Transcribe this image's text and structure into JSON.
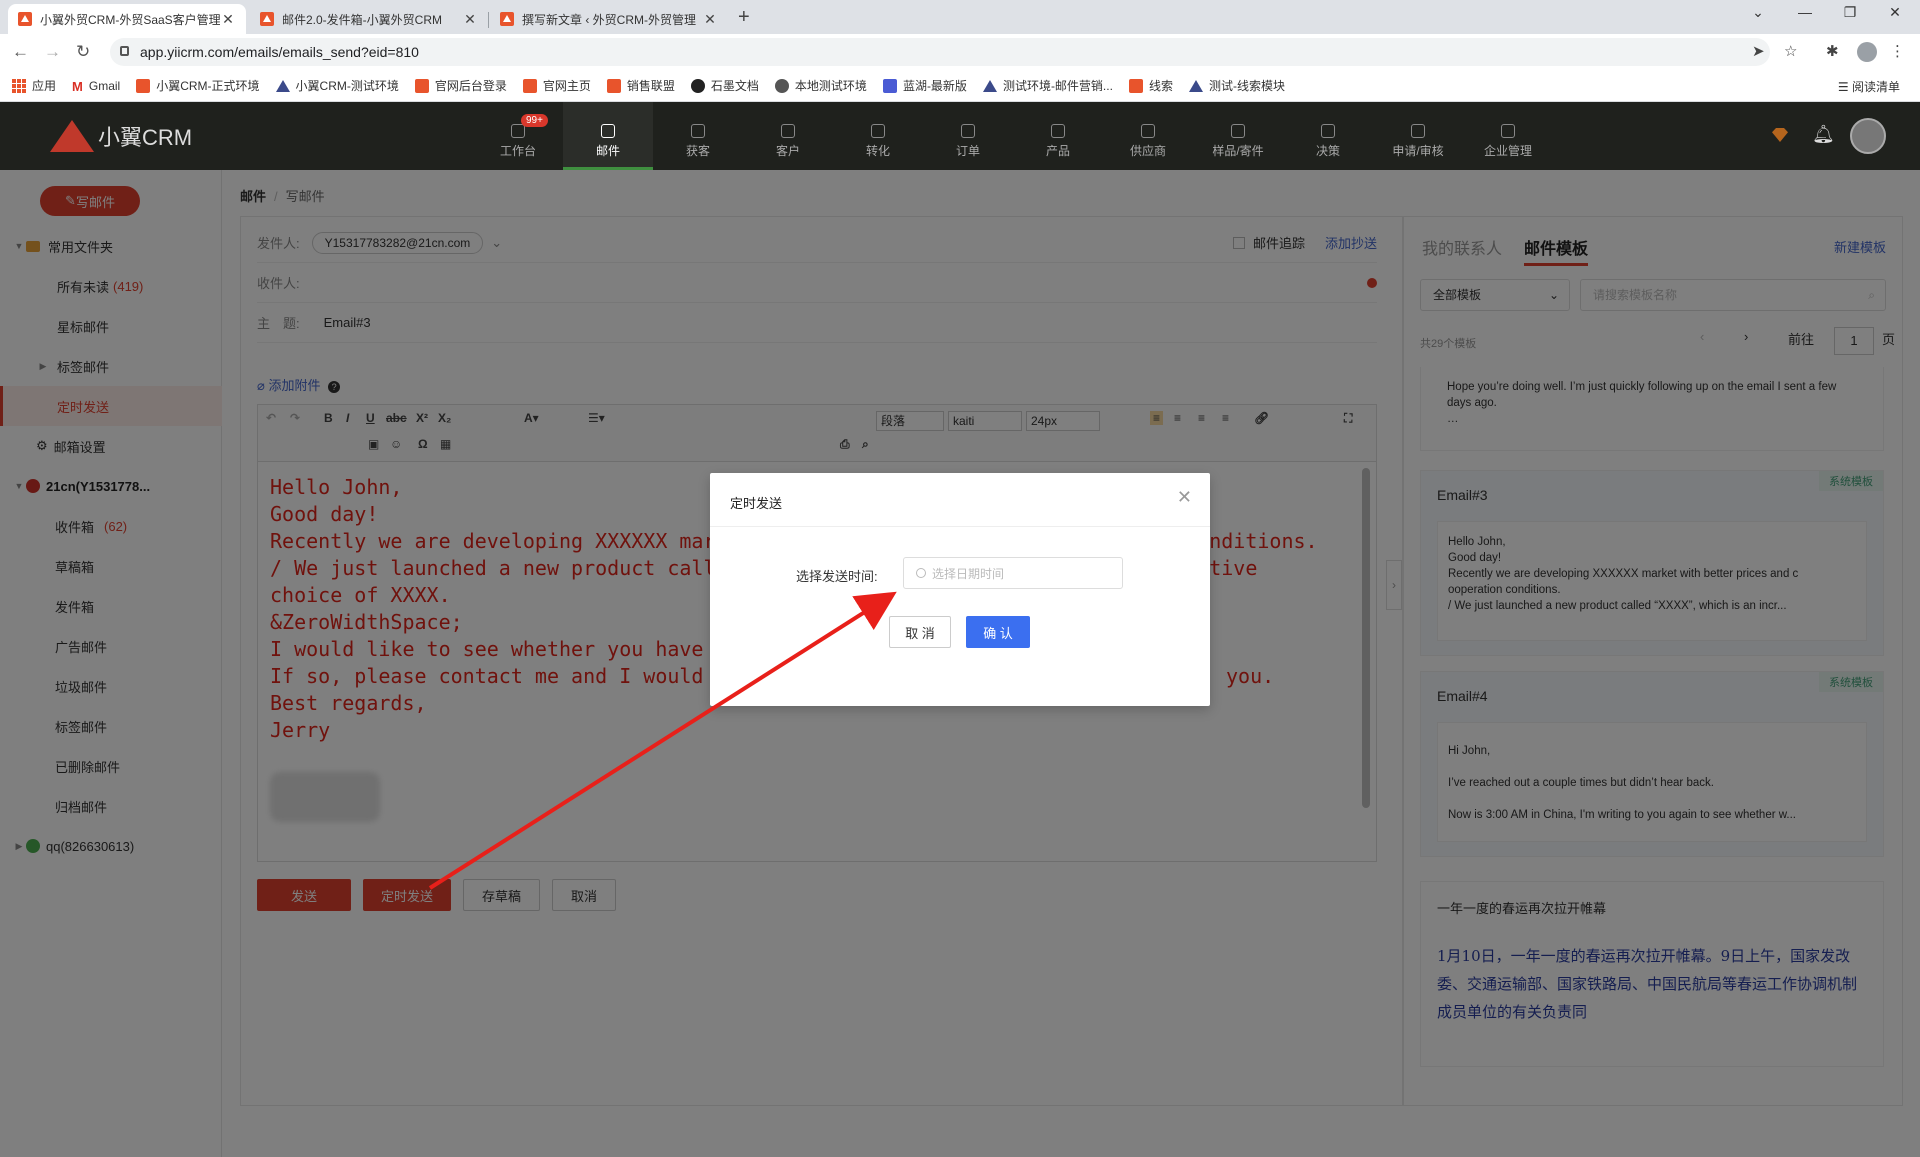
{
  "browser": {
    "tabs": [
      {
        "title": "小翼外贸CRM-外贸SaaS客户管理"
      },
      {
        "title": "邮件2.0-发件箱-小翼外贸CRM"
      },
      {
        "title": "撰写新文章 ‹ 外贸CRM-外贸管理"
      }
    ],
    "url": "app.yiicrm.com/emails/emails_send?eid=810",
    "bookmarks": [
      "应用",
      "Gmail",
      "小翼CRM-正式环境",
      "小翼CRM-测试环境",
      "官网后台登录",
      "官网主页",
      "销售联盟",
      "石墨文档",
      "本地测试环境",
      "蓝湖-最新版",
      "测试环境-邮件营销...",
      "线索",
      "测试-线索模块"
    ],
    "reading_list": "阅读清单"
  },
  "app": {
    "logo": "小翼CRM",
    "nav": [
      {
        "label": "工作台",
        "badge": "99+"
      },
      {
        "label": "邮件"
      },
      {
        "label": "获客"
      },
      {
        "label": "客户"
      },
      {
        "label": "转化"
      },
      {
        "label": "订单"
      },
      {
        "label": "产品"
      },
      {
        "label": "供应商"
      },
      {
        "label": "样品/寄件"
      },
      {
        "label": "决策"
      },
      {
        "label": "申请/审核"
      },
      {
        "label": "企业管理"
      }
    ]
  },
  "sidebar": {
    "compose": "写邮件",
    "common_folder": "常用文件夹",
    "items": [
      {
        "label": "所有未读",
        "count": "(419)"
      },
      {
        "label": "星标邮件"
      },
      {
        "label": "标签邮件"
      },
      {
        "label": "定时发送"
      },
      {
        "label": "邮箱设置"
      }
    ],
    "account1": "21cn(Y1531778...",
    "account1_items": [
      {
        "label": "收件箱",
        "count": "(62)"
      },
      {
        "label": "草稿箱"
      },
      {
        "label": "发件箱"
      },
      {
        "label": "广告邮件"
      },
      {
        "label": "垃圾邮件"
      },
      {
        "label": "标签邮件"
      },
      {
        "label": "已删除邮件"
      },
      {
        "label": "归档邮件"
      }
    ],
    "account2": "qq(826630613)"
  },
  "breadcrumb": {
    "root": "邮件",
    "current": "写邮件"
  },
  "compose": {
    "from_label": "发件人:",
    "from_value": "Y15317783282@21cn.com",
    "track_label": "邮件追踪",
    "add_cc": "添加抄送",
    "to_label": "收件人:",
    "subject_label": "主　题:",
    "subject_value": "Email#3",
    "attach": "添加附件",
    "toolbar": {
      "paragraph": "段落",
      "font": "kaiti",
      "size": "24px"
    },
    "body_lines": [
      "Hello John,",
      "Good day!",
      "Recently we are developing XXXXXX market with better prices and cooperation conditions.",
      "/ We just launched a new product called \"XXXX\", which is an incredible alternative",
      "choice of XXXX.",
      "&ZeroWidthSpace;",
      "I would like to see whether you have",
      "If so, please contact me and I would",
      "Best regards,",
      "Jerry"
    ],
    "body_line_frag_6": "you.",
    "btn_send": "发送",
    "btn_schedule": "定时发送",
    "btn_draft": "存草稿",
    "btn_cancel": "取消"
  },
  "right_panel": {
    "tab_contacts": "我的联系人",
    "tab_templates": "邮件模板",
    "new_template": "新建模板",
    "filter_all": "全部模板",
    "search_placeholder": "请搜索模板名称",
    "total": "共29个模板",
    "goto": "前往",
    "page": "1",
    "page_unit": "页",
    "cards": [
      {
        "title": "",
        "tag": "",
        "lines": [
          "Hope you’re doing well. I’m just quickly following up on the email I sent a few days ago.",
          "…"
        ]
      },
      {
        "title": "Email#3",
        "tag": "系统模板",
        "lines": [
          "Hello John,",
          "Good day!",
          "Recently we are developing XXXXXX market with better prices and c",
          "ooperation conditions.",
          "/ We just launched a new product called “XXXX”, which is an incr..."
        ]
      },
      {
        "title": "Email#4",
        "tag": "系统模板",
        "lines": [
          "Hi John,",
          "I’ve reached out a couple times but didn’t hear back.",
          "Now is 3:00 AM in China, I'm writing to you again to see whether w..."
        ]
      },
      {
        "title": "一年一度的春运再次拉开帷幕",
        "tag": "",
        "lines": [
          "1月10日，一年一度的春运再次拉开帷幕。9日上午，国家发改委、交通运输部、国家铁路局、中国民航局等春运工作协调机制成员单位的有关负责同"
        ]
      }
    ]
  },
  "modal": {
    "title": "定时发送",
    "label": "选择发送时间:",
    "placeholder": "选择日期时间",
    "cancel": "取 消",
    "confirm": "确 认"
  },
  "colors": {
    "brand": "#e0402e",
    "primary_blue": "#3b6ff0",
    "annotation_arrow": "#e8201a"
  }
}
